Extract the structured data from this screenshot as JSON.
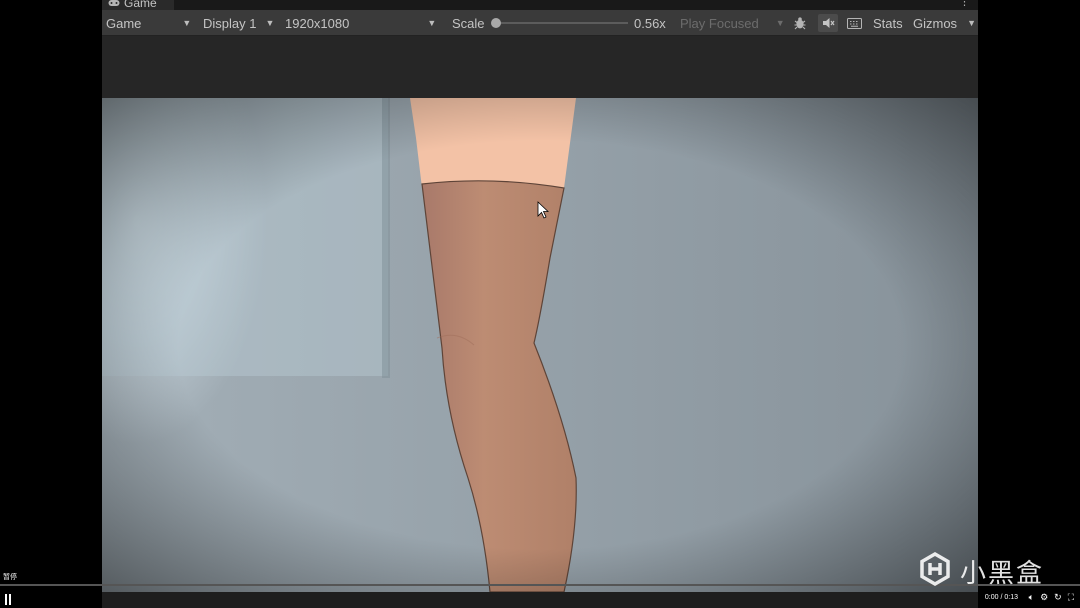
{
  "tab": {
    "title": "Game"
  },
  "toolbar": {
    "mode": "Game",
    "display": "Display 1",
    "resolution": "1920x1080",
    "scale_label": "Scale",
    "scale_value": "0.56x",
    "play_mode": "Play Focused",
    "stats_label": "Stats",
    "gizmos_label": "Gizmos"
  },
  "video": {
    "time": "0:00 / 0:13",
    "pause_label": "暂停"
  },
  "watermark": {
    "text": "小黑盒"
  },
  "colors": {
    "panel_bg": "#1e1e1e",
    "toolbar_bg": "#3a3a3a",
    "skin": "#f3c2a6",
    "stocking": "#b7876f",
    "background_wall": "#8f9aa2"
  }
}
